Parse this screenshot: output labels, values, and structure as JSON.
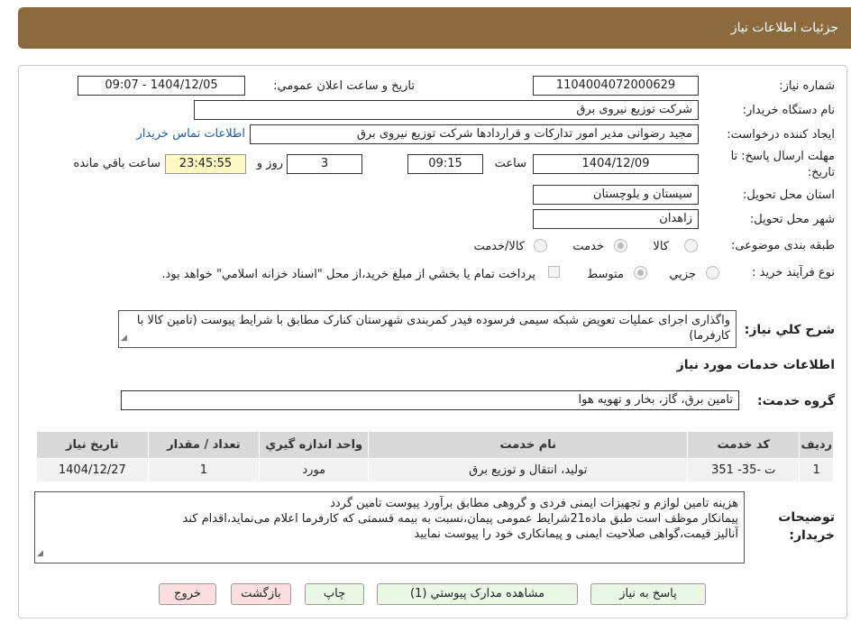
{
  "header": {
    "title": "جزئیات اطلاعات نیاز"
  },
  "form": {
    "need_number_label": "شماره نیاز:",
    "need_number": "1104004072000629",
    "announce_label": "تاریخ و ساعت اعلان عمومي:",
    "announce_value": "1404/12/05 - 09:07",
    "buyer_org_label": "نام دستگاه خريدار:",
    "buyer_org": "شرکت توزیع نیروی برق",
    "requester_label": "ايجاد کننده درخواست:",
    "requester": "مجید  رضوانی مدیر امور تدارکات و قراردادها شرکت توزیع نیروی برق",
    "contact_link": "اطلاعات تماس خريدار",
    "deadline_label_1": "مهلت ارسال پاسخ: تا",
    "deadline_label_2": "تاريخ:",
    "deadline_date": "1404/12/09",
    "time_label": "ساعت",
    "deadline_time": "09:15",
    "days_value": "3",
    "days_label": "روز و",
    "remaining_time": "23:45:55",
    "remaining_label": "ساعت باقي مانده",
    "province_label": "استان محل تحويل:",
    "province": "سيستان و بلوچستان",
    "city_label": "شهر محل تحويل:",
    "city": "زاهدان",
    "category_label": "طبقه بندی موضوعی:",
    "category_options": [
      "کالا",
      "خدمت",
      "کالا/خدمت"
    ],
    "process_label": "نوع فرآيند خريد :",
    "process_options": [
      "جزيي",
      "متوسط"
    ],
    "payment_note": "پرداخت تمام يا بخشي از مبلغ خريد،از محل \"اسناد خزانه اسلامي\" خواهد بود."
  },
  "description": {
    "label": "شرح کلي نياز:",
    "text": "واگذاری اجرای عملیات تعویض شبکه سیمی فرسوده فیدر کمربندی شهرستان کنارک مطابق با شرایط پیوست (تامین کالا با کارفرما)"
  },
  "services": {
    "section_title": "اطلاعات خدمات مورد نياز",
    "group_label": "گروه خدمت:",
    "group_value": "تامین برق، گاز، بخار و تهویه هوا",
    "columns": [
      "رديف",
      "کد خدمت",
      "نام خدمت",
      "واحد اندازه گيري",
      "تعداد / مقدار",
      "تاريخ نياز"
    ],
    "rows": [
      [
        "1",
        "ت -35- 351",
        "تولید، انتقال و توزیع برق",
        "مورد",
        "1",
        "1404/12/27"
      ]
    ]
  },
  "buyer_notes": {
    "label_1": "توضيحات",
    "label_2": "خريدار:",
    "line1": "هزینه تامین لوازم و تجهیزات ایمنی فردی و گروهی مطابق برآورد پیوست تامین گردد",
    "line2": "پیمانکار موظف است طبق ماده21شرایط عمومی پیمان،نسبت به بیمه قسمتی که کارفرما اعلام می‌نماید،اقدام کند",
    "line3": "آنالیز قیمت،گواهی صلاحیت ایمنی و پیمانکاری خود را پیوست نمایید"
  },
  "buttons": {
    "reply": "پاسخ به نياز",
    "attachments": "مشاهده مدارک پيوستي (1)",
    "print": "چاپ",
    "back": "بازگشت",
    "exit": "خروج"
  },
  "watermark": "AriaTender.neT"
}
